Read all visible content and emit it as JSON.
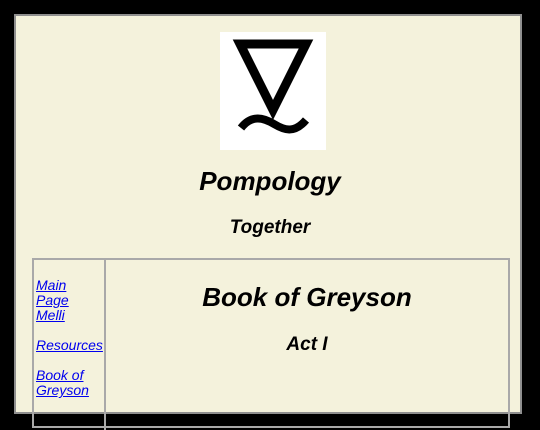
{
  "logo": {
    "icon": "triangle-tilde-symbol-icon"
  },
  "site": {
    "title": "Pompology",
    "subtitle": "Together"
  },
  "nav": {
    "items": [
      {
        "label": "Main Page"
      },
      {
        "label": "Melli"
      },
      {
        "label": "Resources"
      },
      {
        "label": "Book of Greyson"
      }
    ]
  },
  "content": {
    "title": "Book of Greyson",
    "section": "Act I"
  },
  "colors": {
    "background": "#f4f2dc",
    "page_border": "#000000",
    "link": "#0000ee"
  }
}
